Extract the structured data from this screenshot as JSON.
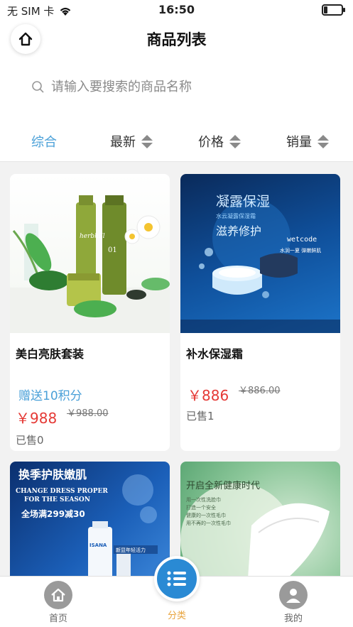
{
  "status_bar": {
    "carrier": "无 SIM 卡",
    "time": "16:50",
    "battery_level": 0.2
  },
  "nav": {
    "title": "商品列表"
  },
  "search": {
    "placeholder": "请输入要搜索的商品名称",
    "value": ""
  },
  "sort": [
    {
      "label": "综合",
      "active": true
    },
    {
      "label": "最新",
      "active": false
    },
    {
      "label": "价格",
      "active": false
    },
    {
      "label": "销量",
      "active": false
    }
  ],
  "products": [
    {
      "name": "美白亮肤套装",
      "promo": "赠送10积分",
      "price": "￥988",
      "original_price": "￥988.00",
      "sold": "已售0",
      "image_brand": "herbhill",
      "image_series": "01"
    },
    {
      "name": "补水保湿霜",
      "price": "￥886",
      "original_price": "￥886.00",
      "sold": "已售1",
      "image_headline": "凝露保湿",
      "image_subline": "水云凝露保湿霜",
      "image_tagline": "滋养修护",
      "image_brand": "wetcode",
      "image_slogan": "水润一夏 弹嫩鲜肌"
    },
    {
      "image_headline": "换季护肤嫩肌",
      "image_en_line1": "CHANGE DRESS PROPER",
      "image_en_line2": "FOR THE SEASON",
      "image_offer": "全场满299减30",
      "image_tag": "新显年轻活力",
      "image_brand": "ISANA"
    },
    {
      "image_headline": "开启全新健康时代",
      "image_lines": [
        "用一次性洗脸巾",
        "打造一个安全",
        "健康的一次性毛巾",
        "用不再的一次性毛巾"
      ]
    }
  ],
  "tabs": {
    "home": "首页",
    "category": "分类",
    "mine": "我的"
  },
  "colors": {
    "accent": "#4aa0d8",
    "price": "#e53935",
    "tab_active": "#2a8ad4",
    "category_label": "#e8a33c"
  }
}
